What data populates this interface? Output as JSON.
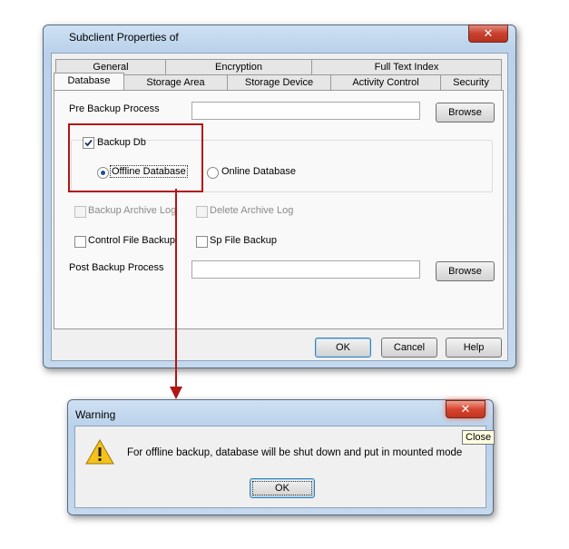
{
  "dialog": {
    "title": "Subclient Properties of",
    "close_glyph": "✕",
    "tabs_row1": [
      "General",
      "Encryption",
      "Full Text Index"
    ],
    "tabs_row2": [
      "Database",
      "Storage Area",
      "Storage Device",
      "Activity Control",
      "Security"
    ],
    "active_tab": "Database",
    "pre_backup_label": "Pre Backup Process",
    "pre_backup_value": "",
    "browse_label": "Browse",
    "backup_db_label": "Backup Db",
    "backup_db_checked": true,
    "offline_db_label": "Offline Database",
    "offline_selected": true,
    "online_db_label": "Online Database",
    "backup_archive_log_label": "Backup Archive Log",
    "delete_archive_log_label": "Delete Archive Log",
    "control_file_backup_label": "Control File Backup",
    "sp_file_backup_label": "Sp File Backup",
    "post_backup_label": "Post Backup Process",
    "post_backup_value": "",
    "ok_label": "OK",
    "cancel_label": "Cancel",
    "help_label": "Help"
  },
  "warning": {
    "title": "Warning",
    "message": "For offline backup, database will be shut down and put in mounted mode",
    "ok_label": "OK",
    "close_glyph": "✕",
    "close_tooltip": "Close",
    "icon": "warning-triangle-icon"
  },
  "colors": {
    "highlight_red": "#b31414",
    "close_red": "#c9402f"
  }
}
